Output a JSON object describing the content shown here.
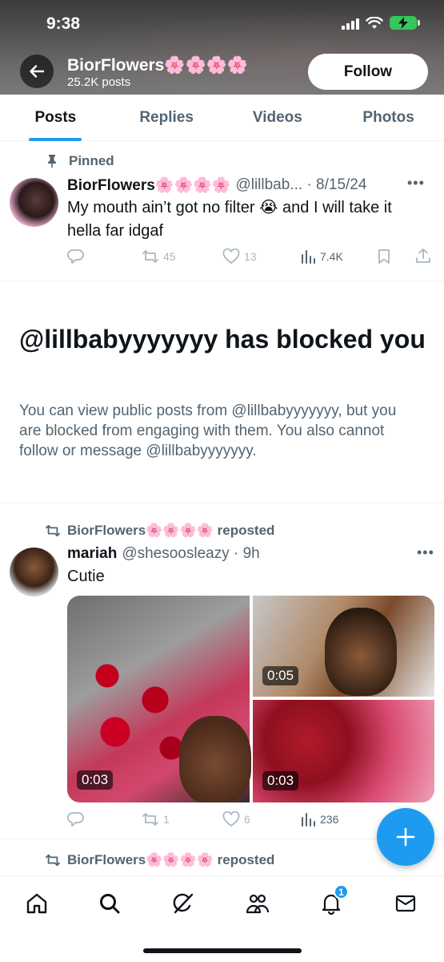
{
  "status_bar": {
    "time": "9:38"
  },
  "header": {
    "name": "BiorFlowers🌸🌸🌸🌸",
    "post_count": "25.2K posts",
    "follow_label": "Follow"
  },
  "tabs": [
    {
      "label": "Posts",
      "active": true
    },
    {
      "label": "Replies",
      "active": false
    },
    {
      "label": "Videos",
      "active": false
    },
    {
      "label": "Photos",
      "active": false
    }
  ],
  "pinned_post": {
    "pinned_label": "Pinned",
    "name": "BiorFlowers🌸🌸🌸🌸",
    "handle_date": "@lillbab... · 8/15/24",
    "text": "My mouth ain’t got no filter 😭 and I will take it hella far idgaf",
    "reposts": "45",
    "likes": "13",
    "views": "7.4K"
  },
  "blocked": {
    "title": "@lillbabyyyyyyy has blocked you",
    "description": "You can view public posts from @lillbabyyyyyyy, but you are blocked from engaging with them. You also cannot follow or message @lillbabyyyyyyy."
  },
  "repost_1": {
    "reposted_by": "BiorFlowers🌸🌸🌸🌸 reposted",
    "name": "mariah",
    "handle_time": "@shesoosleazy · 9h",
    "text": "Cutie",
    "media_durations": [
      "0:03",
      "0:05",
      "0:03"
    ],
    "reposts": "1",
    "likes": "6",
    "views": "236"
  },
  "repost_2": {
    "reposted_by": "BiorFlowers🌸🌸🌸🌸 reposted"
  },
  "bottom_nav": {
    "notification_badge": "1",
    "items": [
      "home-icon",
      "search-icon",
      "grok-icon",
      "communities-icon",
      "notifications-icon",
      "messages-icon"
    ]
  },
  "colors": {
    "accent": "#1d9bf0",
    "text": "#0f1419",
    "secondary": "#536471"
  }
}
